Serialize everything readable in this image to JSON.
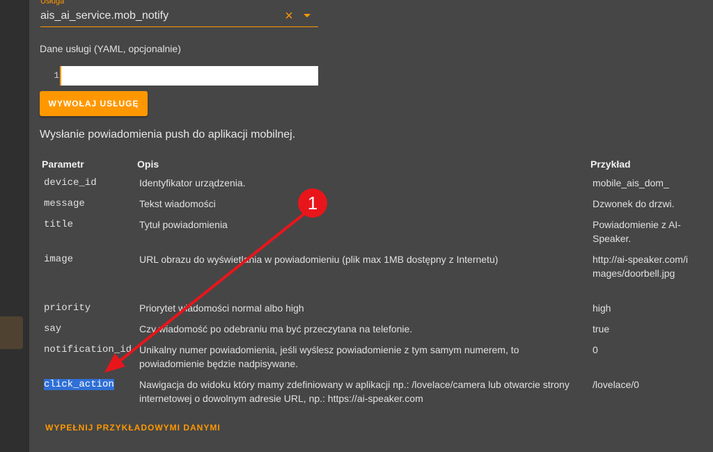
{
  "service": {
    "label": "Usługa",
    "value": "ais_ai_service.mob_notify",
    "clear_icon": "×"
  },
  "yaml": {
    "label": "Dane usługi (YAML, opcjonalnie)",
    "line_number": "1",
    "value": ""
  },
  "call_button": "WYWOŁAJ USŁUGĘ",
  "description": "Wysłanie powiadomienia push do aplikacji mobilnej.",
  "table": {
    "headers": {
      "param": "Parametr",
      "desc": "Opis",
      "example": "Przykład"
    },
    "rows": [
      {
        "param": "device_id",
        "desc": "Identyfikator urządzenia.",
        "example": "mobile_ais_dom_"
      },
      {
        "param": "message",
        "desc": "Tekst wiadomości",
        "example": "Dzwonek do drzwi."
      },
      {
        "param": "title",
        "desc": "Tytuł powiadomienia",
        "example": "Powiadomienie z AI-Speaker."
      },
      {
        "param": "image",
        "desc": "URL obrazu do wyświetlania w powiadomieniu (plik max 1MB dostępny z Internetu)",
        "example": "http://ai-speaker.com/images/doorbell.jpg"
      },
      {
        "param": "priority",
        "desc": "Priorytet wiadomości normal albo high",
        "example": "high"
      },
      {
        "param": "say",
        "desc": "Czy wiadomość po odebraniu ma być przeczytana na telefonie.",
        "example": "true"
      },
      {
        "param": "notification_id",
        "desc": "Unikalny numer powiadomienia, jeśli wyślesz powiadomienie z tym samym numerem, to powiadomienie będzie nadpisywane.",
        "example": "0"
      },
      {
        "param": "click_action",
        "desc": "Nawigacja do widoku który mamy zdefiniowany w aplikacji np.: /lovelace/camera lub otwarcie strony internetowej o dowolnym adresie URL, np.: https://ai-speaker.com",
        "example": "/lovelace/0"
      }
    ]
  },
  "fill_link": "WYPEŁNIJ PRZYKŁADOWYMI DANYMI",
  "annotation": {
    "number": "1",
    "color": "#e8161b"
  },
  "colors": {
    "accent": "#ff9800",
    "background": "#464646",
    "sidebar": "#2f2f2f"
  }
}
